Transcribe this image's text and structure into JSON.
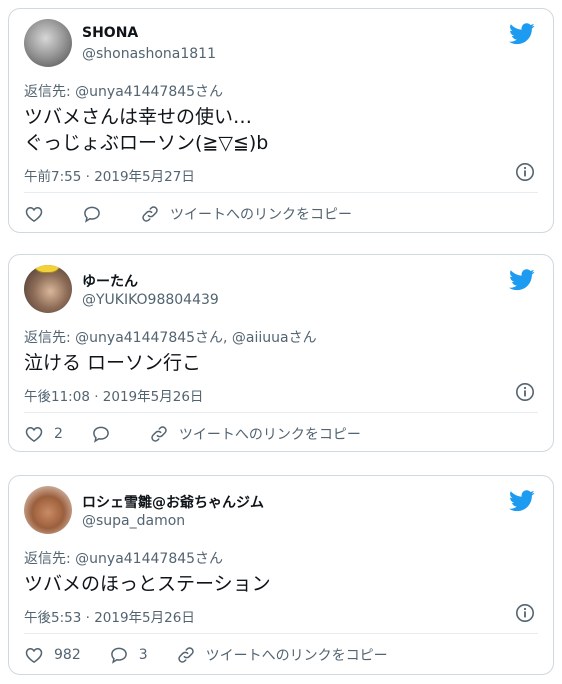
{
  "colors": {
    "twitter_blue": "#1d9bf0",
    "muted": "#536471",
    "text": "#0f1419",
    "border": "#cfd9de"
  },
  "tweets": [
    {
      "name": "SHONA",
      "handle": "@shonashona1811",
      "reply_to": "返信先: @unya41447845さん",
      "text_lines": [
        "ツバメさんは幸せの使い…",
        "ぐっじょぶローソン(≧▽≦)b"
      ],
      "timestamp": "午前7:55 · 2019年5月27日",
      "likes": "",
      "replies": "",
      "copy_label": "ツイートへのリンクをコピー"
    },
    {
      "name": "ゆーたん",
      "handle": "@YUKIKO98804439",
      "reply_to": "返信先: @unya41447845さん, @aiiuuaさん",
      "text_lines": [
        "泣ける ローソン行こ"
      ],
      "timestamp": "午後11:08 · 2019年5月26日",
      "likes": "2",
      "replies": "",
      "copy_label": "ツイートへのリンクをコピー"
    },
    {
      "name": "ロシェ雪雛@お爺ちゃんジム",
      "handle": "@supa_damon",
      "reply_to": "返信先: @unya41447845さん",
      "text_lines": [
        "ツバメのほっとステーション"
      ],
      "timestamp": "午後5:53 · 2019年5月26日",
      "likes": "982",
      "replies": "3",
      "copy_label": "ツイートへのリンクをコピー"
    }
  ]
}
